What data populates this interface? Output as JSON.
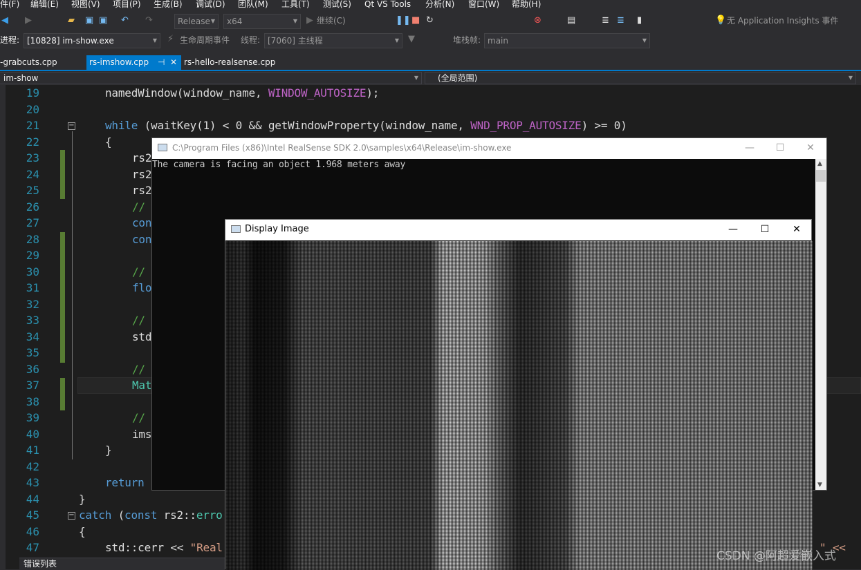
{
  "menu": [
    "件(F)",
    "编辑(E)",
    "视图(V)",
    "项目(P)",
    "生成(B)",
    "调试(D)",
    "团队(M)",
    "工具(T)",
    "测试(S)",
    "Qt VS Tools",
    "分析(N)",
    "窗口(W)",
    "帮助(H)"
  ],
  "toolbar": {
    "config": "Release",
    "platform": "x64",
    "continue": "继续(C)",
    "insights": "无 Application Insights 事件"
  },
  "debugbar": {
    "process_label": "进程:",
    "process": "[10828] im-show.exe",
    "lifecycle": "生命周期事件",
    "thread_label": "线程:",
    "thread": "[7060] 主线程",
    "stack_label": "堆栈帧:",
    "stack": "main"
  },
  "tabs": [
    {
      "label": "-grabcuts.cpp"
    },
    {
      "label": "rs-imshow.cpp",
      "active": true
    },
    {
      "label": "rs-hello-realsense.cpp"
    }
  ],
  "navbar": {
    "project": "im-show",
    "scope": "(全局范围)"
  },
  "code": {
    "line_numbers": [
      "19",
      "20",
      "21",
      "22",
      "23",
      "24",
      "25",
      "26",
      "27",
      "28",
      "29",
      "30",
      "31",
      "32",
      "33",
      "34",
      "35",
      "36",
      "37",
      "38",
      "39",
      "40",
      "41",
      "42",
      "43",
      "44",
      "45",
      "46",
      "47"
    ],
    "l19a": "namedWindow(window_name, ",
    "l19b": "WINDOW_AUTOSIZE",
    "l19c": ");",
    "l21a": "while",
    "l21b": " (waitKey(1) < 0 && getWindowProperty(window_name, ",
    "l21c": "WND_PROP_AUTOSIZE",
    "l21d": ") >= 0)",
    "l22": "{",
    "l23": "rs2",
    "l24": "rs2",
    "l25": "rs2",
    "l26": "//",
    "l27": "con",
    "l28": "con",
    "l30": "//",
    "l31": "flo",
    "l33": "//",
    "l34": "std",
    "l36": "//",
    "l37": "Mat",
    "l39": "//",
    "l40": "ims",
    "l41": "}",
    "l43": "return",
    "l44": "}",
    "l45a": "catch",
    "l45b": " (",
    "l45c": "const",
    "l45d": " rs2::",
    "l45e": "erro",
    "l46": "{",
    "l47a": "std::cerr << ",
    "l47b": "\"Real",
    "l47c": "\" <<"
  },
  "console": {
    "title": "C:\\Program Files (x86)\\Intel RealSense SDK 2.0\\samples\\x64\\Release\\im-show.exe",
    "output": "The camera is facing an object 1.968 meters away"
  },
  "display": {
    "title": "Display Image"
  },
  "bottom_panel": {
    "label": "错误列表"
  },
  "watermark": "CSDN @阿超爱嵌入式",
  "colors": {
    "accent": "#007acc",
    "change_bar": "#587c33",
    "editor_bg": "#1e1e1e"
  }
}
